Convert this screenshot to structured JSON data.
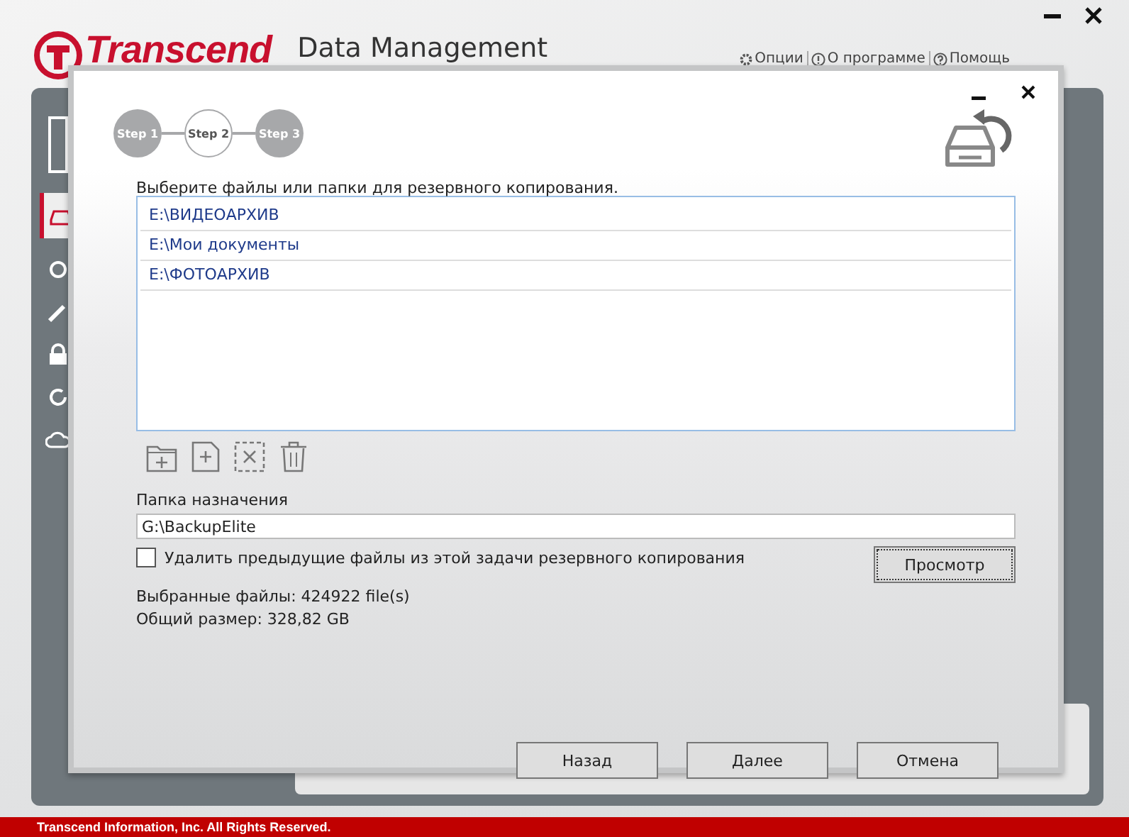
{
  "app": {
    "brand": "Transcend",
    "title": "Data Management",
    "menu": [
      {
        "label": "Опции",
        "kind": "gear"
      },
      {
        "label": "О программе",
        "kind": "info"
      },
      {
        "label": "Помощь",
        "kind": "help"
      }
    ],
    "footer": "Transcend Information, Inc. All Rights Reserved."
  },
  "dialog": {
    "steps": [
      {
        "label": "Step 1",
        "selected": false
      },
      {
        "label": "Step 2",
        "selected": true
      },
      {
        "label": "Step 3",
        "selected": false
      }
    ],
    "prompt": "Выберите файлы или папки для резервного копирования.",
    "sources": [
      "E:\\ВИДЕОАРХИВ",
      "E:\\Мои документы",
      "E:\\ФОТОАРХИВ"
    ],
    "destination_label": "Папка назначения",
    "destination": "G:\\BackupElite",
    "delete_previous": {
      "label": "Удалить предыдущие файлы из этой задачи резервного копирования",
      "checked": false
    },
    "browse_button": "Просмотр",
    "selected_files": "Выбранные файлы: 424922 file(s)",
    "total_size": "Общий размер: 328,82 GB",
    "buttons": [
      "Назад",
      "Далее",
      "Отмена"
    ]
  }
}
